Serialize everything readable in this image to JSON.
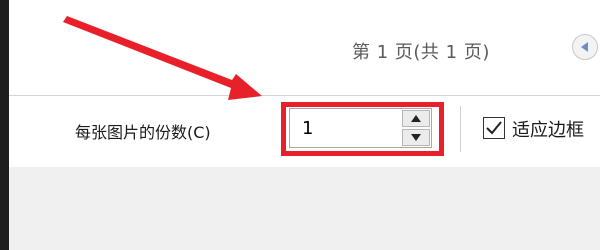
{
  "preview": {
    "page_indicator": "第 1 页(共 1 页)",
    "prev_icon": "chevron-left-icon"
  },
  "print_options": {
    "copies_label": "每张图片的份数(C)",
    "copies_value": "1",
    "fit_frame_label": "适应边框",
    "fit_frame_checked": true
  },
  "annotation": {
    "highlight_color": "#e8202a",
    "arrow_color": "#e8202a"
  }
}
